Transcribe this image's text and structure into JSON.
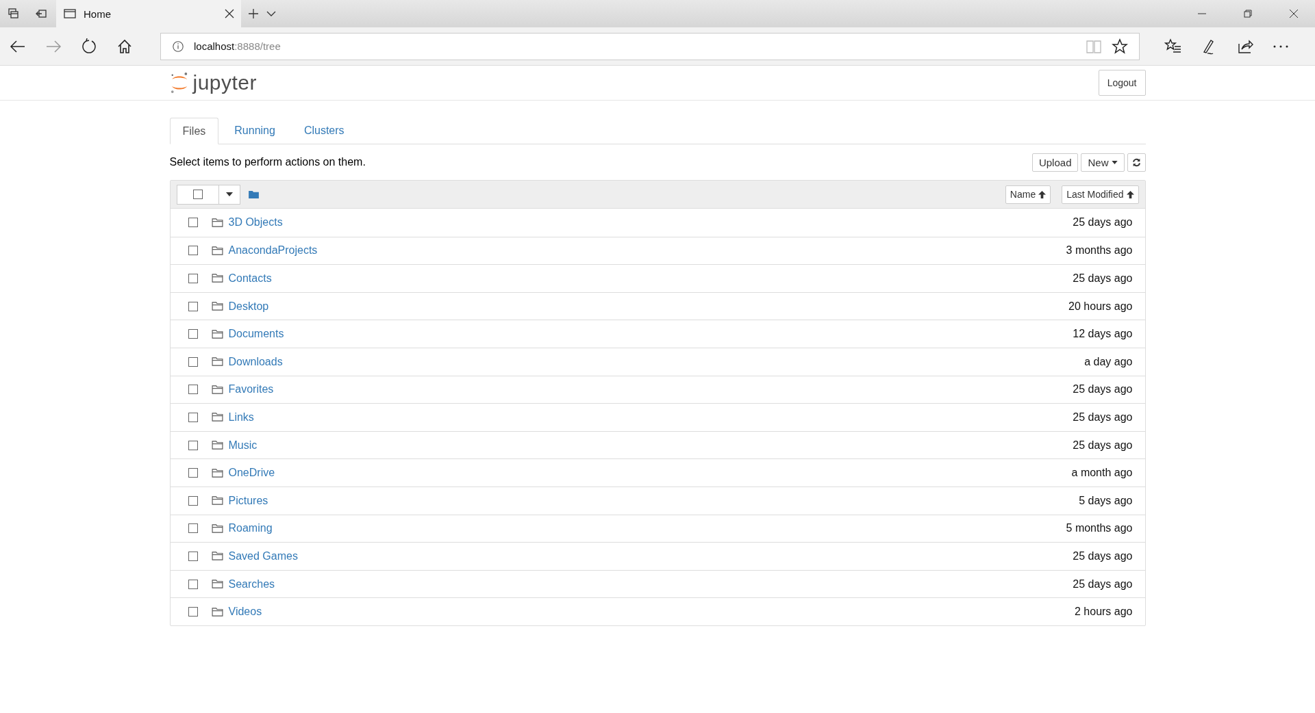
{
  "browser": {
    "tabs": [
      {
        "title": "Home",
        "selected": true
      }
    ],
    "address": {
      "host": "localhost",
      "path": ":8888/tree"
    }
  },
  "header": {
    "logo_text": "jupyter",
    "logout": "Logout"
  },
  "tabs": [
    {
      "label": "Files",
      "selected": true
    },
    {
      "label": "Running",
      "selected": false
    },
    {
      "label": "Clusters",
      "selected": false
    }
  ],
  "hint": "Select items to perform actions on them.",
  "actions": {
    "upload": "Upload",
    "new": "New"
  },
  "list_header": {
    "select_all_checked": false,
    "columns": [
      "Name",
      "Last Modified"
    ]
  },
  "rows": [
    {
      "name": "3D Objects",
      "modified": "25 days ago",
      "checked": false
    },
    {
      "name": "AnacondaProjects",
      "modified": "3 months ago",
      "checked": false
    },
    {
      "name": "Contacts",
      "modified": "25 days ago",
      "checked": false
    },
    {
      "name": "Desktop",
      "modified": "20 hours ago",
      "checked": false
    },
    {
      "name": "Documents",
      "modified": "12 days ago",
      "checked": false
    },
    {
      "name": "Downloads",
      "modified": "a day ago",
      "checked": false
    },
    {
      "name": "Favorites",
      "modified": "25 days ago",
      "checked": false
    },
    {
      "name": "Links",
      "modified": "25 days ago",
      "checked": false
    },
    {
      "name": "Music",
      "modified": "25 days ago",
      "checked": false
    },
    {
      "name": "OneDrive",
      "modified": "a month ago",
      "checked": false
    },
    {
      "name": "Pictures",
      "modified": "5 days ago",
      "checked": false
    },
    {
      "name": "Roaming",
      "modified": "5 months ago",
      "checked": false
    },
    {
      "name": "Saved Games",
      "modified": "25 days ago",
      "checked": false
    },
    {
      "name": "Searches",
      "modified": "25 days ago",
      "checked": false
    },
    {
      "name": "Videos",
      "modified": "2 hours ago",
      "checked": false
    }
  ]
}
